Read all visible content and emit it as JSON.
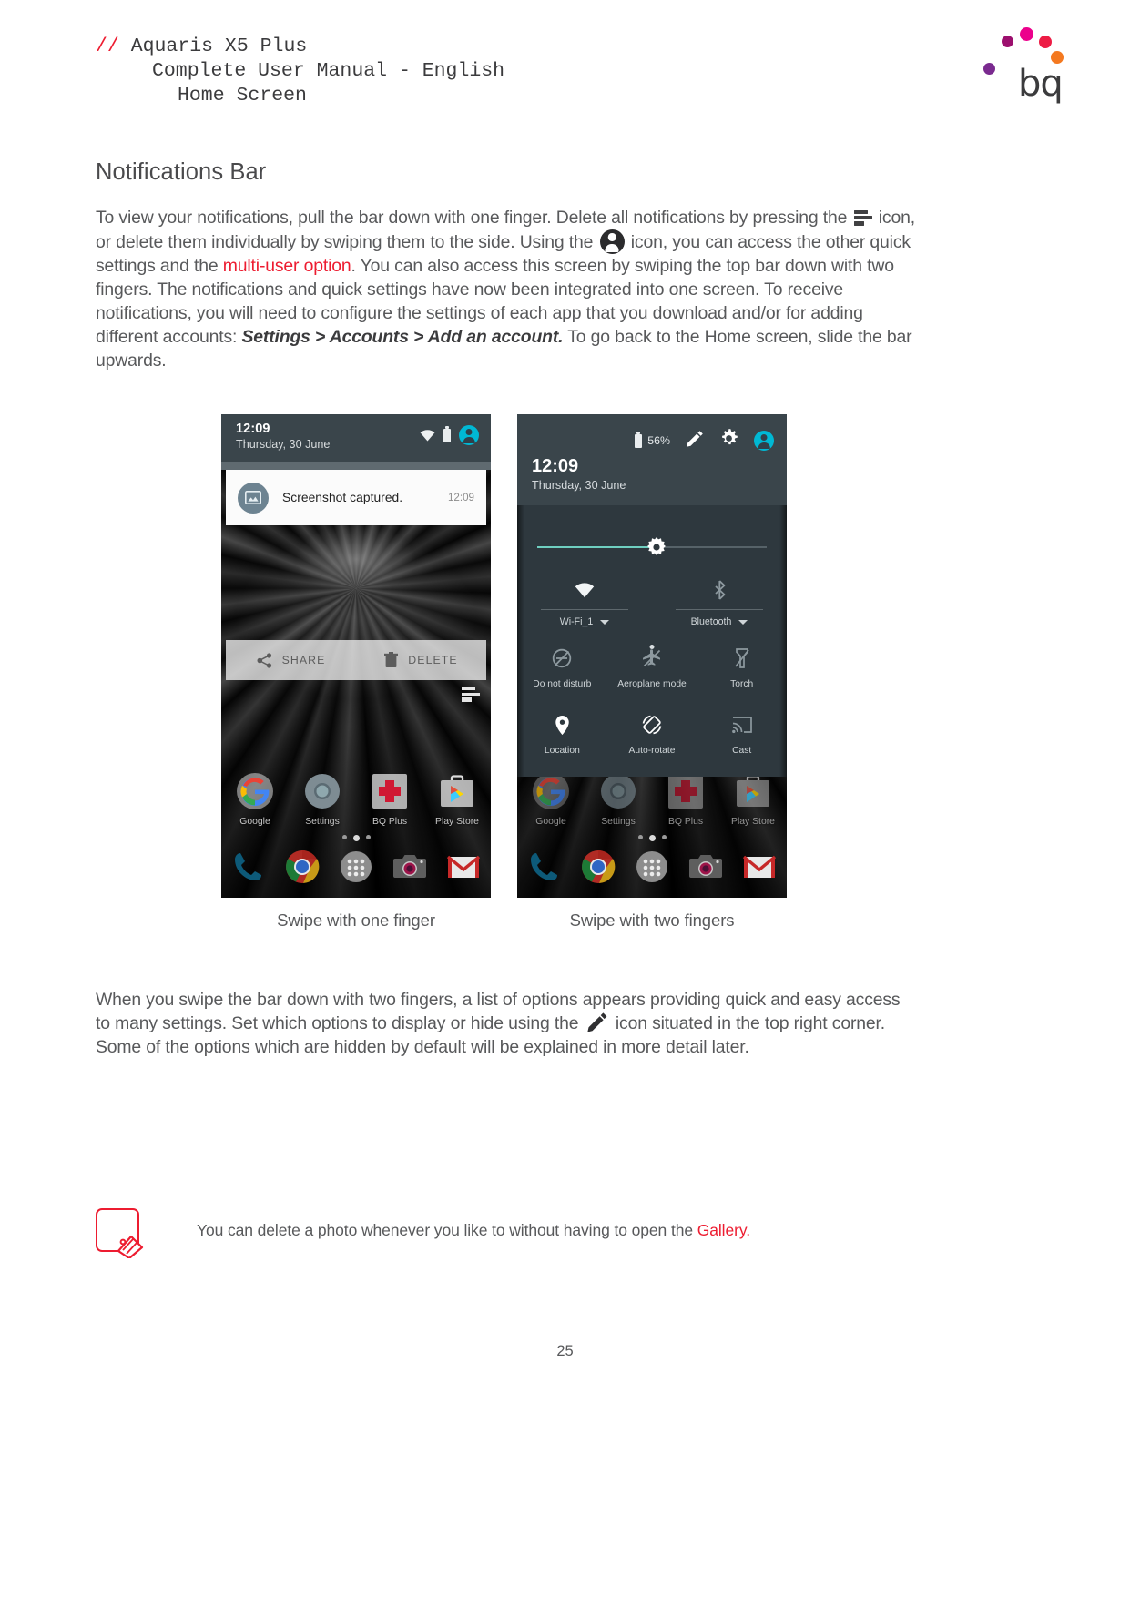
{
  "header": {
    "slashes": "//",
    "line1": "Aquaris X5 Plus",
    "line2": "Complete User Manual - English",
    "line3": "Home Screen",
    "logo_word": "bq",
    "logo_dots": [
      "#7a2a8f",
      "#9c0f6e",
      "#ec008c",
      "#ed1c45",
      "#f47920"
    ]
  },
  "section": {
    "title": "Notifications Bar",
    "paragraph1_part1": "To view your notifications, pull the bar down with one finger. Delete all notifications by pressing the ",
    "paragraph1_part2": " icon, or delete them individually by swiping them to the side. Using the ",
    "paragraph1_part3": " icon, you can access the other quick settings and the ",
    "paragraph1_link": "multi-user option",
    "paragraph1_part4": ". You can also access this screen by swiping the top bar down with two fingers. The notifications and quick settings have now been integrated into one screen. To receive notifications, you will need to configure the settings of each app that you download and/or for adding different accounts: ",
    "paragraph1_bold1": "Settings > Accounts > Add an account.",
    "paragraph1_part5": " To go back to the Home screen, slide the bar upwards.",
    "paragraph2_part1": "When you swipe the bar down with two fingers, a list of options appears providing quick and easy access to many settings. Set which options to display or hide using the ",
    "paragraph2_part2": " icon situated in the top right corner. Some of the options which are hidden by default will be explained in more detail later."
  },
  "figures": {
    "left_caption": "Swipe with one finger",
    "right_caption": "Swipe with two fingers"
  },
  "phone_left": {
    "status_time": "12:09",
    "status_date": "Thursday, 30 June",
    "notification_title": "Screenshot captured.",
    "notification_time": "12:09",
    "action_share": "SHARE",
    "action_delete": "DELETE",
    "apps": [
      {
        "label": "Google"
      },
      {
        "label": "Settings"
      },
      {
        "label": "BQ Plus"
      },
      {
        "label": "Play Store"
      }
    ],
    "dock": [
      "phone-icon",
      "chrome-icon",
      "app-drawer-icon",
      "camera-icon",
      "gmail-icon"
    ]
  },
  "phone_right": {
    "battery_percent": "56%",
    "status_time": "12:09",
    "status_date": "Thursday, 30 June",
    "brightness_value": 52,
    "toggles": [
      {
        "label": "Wi-Fi_1",
        "icon": "wifi-icon"
      },
      {
        "label": "Bluetooth",
        "icon": "bluetooth-icon"
      }
    ],
    "tiles_row1": [
      {
        "label": "Do not disturb",
        "icon": "do-not-disturb-icon"
      },
      {
        "label": "Aeroplane mode",
        "icon": "aeroplane-icon"
      },
      {
        "label": "Torch",
        "icon": "torch-icon"
      }
    ],
    "tiles_row2": [
      {
        "label": "Location",
        "icon": "location-pin-icon"
      },
      {
        "label": "Auto-rotate",
        "icon": "auto-rotate-icon"
      },
      {
        "label": "Cast",
        "icon": "cast-icon"
      }
    ],
    "apps": [
      {
        "label": "Google"
      },
      {
        "label": "Settings"
      },
      {
        "label": "BQ Plus"
      },
      {
        "label": "Play Store"
      }
    ]
  },
  "note": {
    "text_part1": "You can delete a photo whenever you like to without having to open the ",
    "link": "Gallery",
    "text_part2": "."
  },
  "footer": {
    "page_number": "25"
  },
  "colors": {
    "accent_red": "#ed1c30",
    "cyan": "#00b8d4",
    "statusbar": "#3a454b",
    "qs_panel": "#2e383e"
  }
}
